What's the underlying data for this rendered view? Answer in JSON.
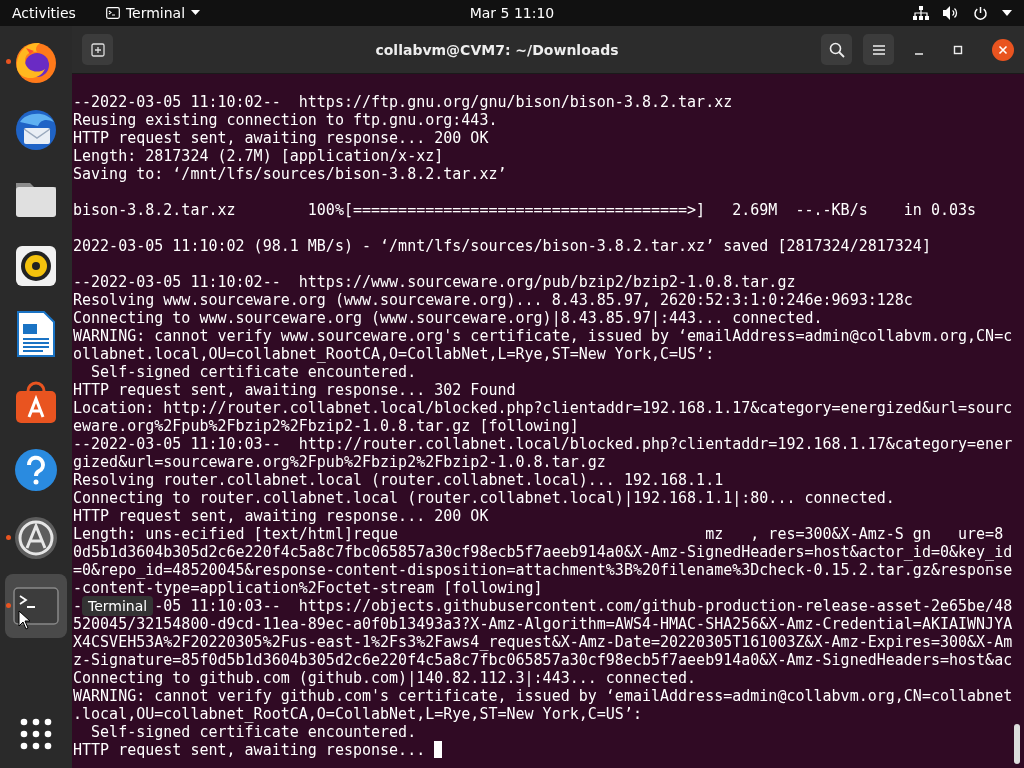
{
  "top_bar": {
    "activities": "Activities",
    "app_menu": "Terminal",
    "clock": "Mar 5  11:10"
  },
  "dock": {
    "items": [
      {
        "kind": "firefox",
        "running": true,
        "selected": false
      },
      {
        "kind": "mail",
        "running": false,
        "selected": false
      },
      {
        "kind": "files",
        "running": false,
        "selected": false
      },
      {
        "kind": "music",
        "running": false,
        "selected": false
      },
      {
        "kind": "writer",
        "running": false,
        "selected": false
      },
      {
        "kind": "store",
        "running": false,
        "selected": false
      },
      {
        "kind": "help",
        "running": false,
        "selected": false
      },
      {
        "kind": "updater",
        "running": true,
        "selected": false
      },
      {
        "kind": "terminal",
        "running": true,
        "selected": true
      }
    ],
    "tooltip": "Terminal"
  },
  "window": {
    "title": "collabvm@CVM7: ~/Downloads"
  },
  "terminal": {
    "lines": [
      {
        "kind": "text",
        "text": "--2022-03-05 11:10:02--  https://ftp.gnu.org/gnu/bison/bison-3.8.2.tar.xz"
      },
      {
        "kind": "text",
        "text": "Reusing existing connection to ftp.gnu.org:443."
      },
      {
        "kind": "text",
        "text": "HTTP request sent, awaiting response... 200 OK"
      },
      {
        "kind": "text",
        "text": "Length: 2817324 (2.7M) [application/x-xz]"
      },
      {
        "kind": "text",
        "text": "Saving to: ‘/mnt/lfs/sources/bison-3.8.2.tar.xz’"
      },
      {
        "kind": "blank"
      },
      {
        "kind": "text",
        "text": "bison-3.8.2.tar.xz        100%[=====================================>]   2.69M  --.-KB/s    in 0.03s"
      },
      {
        "kind": "blank"
      },
      {
        "kind": "text",
        "text": "2022-03-05 11:10:02 (98.1 MB/s) - ‘/mnt/lfs/sources/bison-3.8.2.tar.xz’ saved [2817324/2817324]"
      },
      {
        "kind": "blank"
      },
      {
        "kind": "text",
        "text": "--2022-03-05 11:10:02--  https://www.sourceware.org/pub/bzip2/bzip2-1.0.8.tar.gz"
      },
      {
        "kind": "text",
        "text": "Resolving www.sourceware.org (www.sourceware.org)... 8.43.85.97, 2620:52:3:1:0:246e:9693:128c"
      },
      {
        "kind": "text",
        "text": "Connecting to www.sourceware.org (www.sourceware.org)|8.43.85.97|:443... connected."
      },
      {
        "kind": "text",
        "text": "WARNING: cannot verify www.sourceware.org's certificate, issued by ‘emailAddress=admin@collabvm.org,CN=c"
      },
      {
        "kind": "text",
        "text": "ollabnet.local,OU=collabnet_RootCA,O=CollabNet,L=Rye,ST=New York,C=US’:"
      },
      {
        "kind": "text",
        "text": "  Self-signed certificate encountered."
      },
      {
        "kind": "text",
        "text": "HTTP request sent, awaiting response... 302 Found"
      },
      {
        "kind": "text",
        "text": "Location: http://router.collabnet.local/blocked.php?clientaddr=192.168.1.17&category=energized&url=sourc"
      },
      {
        "kind": "text",
        "text": "eware.org%2Fpub%2Fbzip2%2Fbzip2-1.0.8.tar.gz [following]"
      },
      {
        "kind": "text",
        "text": "--2022-03-05 11:10:03--  http://router.collabnet.local/blocked.php?clientaddr=192.168.1.17&category=ener"
      },
      {
        "kind": "text",
        "text": "gized&url=sourceware.org%2Fpub%2Fbzip2%2Fbzip2-1.0.8.tar.gz"
      },
      {
        "kind": "text",
        "text": "Resolving router.collabnet.local (router.collabnet.local)... 192.168.1.1"
      },
      {
        "kind": "text",
        "text": "Connecting to router.collabnet.local (router.collabnet.local)|192.168.1.1|:80... connected."
      },
      {
        "kind": "text",
        "text": "HTTP request sent, awaiting response... 200 OK"
      },
      {
        "kind": "text",
        "text": "Length: uns-ecified [text/html]reque                                  mz   , res=300&X-Amz-S gn   ure=8"
      },
      {
        "kind": "text",
        "text": "0d5b1d3604b305d2c6e220f4c5a8c7fbc065857a30cf98ecb5f7aeeb914a0&X-Amz-SignedHeaders=host&actor_id=0&key_id"
      },
      {
        "kind": "text",
        "text": "=0&repo_id=48520045&response-content-disposition=attachment%3B%20filename%3Dcheck-0.15.2.tar.gz&response"
      },
      {
        "kind": "text",
        "text": "-content-type=application%2Foctet-stream [following]"
      },
      {
        "kind": "covered",
        "segments": [
          "-",
          "-05 11:10:03--  https://objects.githubusercontent.com/github-production-release-asset-2e65be/48"
        ]
      },
      {
        "kind": "text",
        "text": "520045/32154800-d9cd-11ea-89ec-a0f0b13493a3?X-Amz-Algorithm=AWS4-HMAC-SHA256&X-Amz-Credential=AKIAIWNJYA"
      },
      {
        "kind": "text",
        "text": "X4CSVEH53A%2F20220305%2Fus-east-1%2Fs3%2Faws4_request&X-Amz-Date=20220305T161003Z&X-Amz-Expires=300&X-Am"
      },
      {
        "kind": "text",
        "text": "z-Signature=85f0d5b1d3604b305d2c6e220f4c5a8c7fbc065857a30cf98ecb5f7aeeb914a0&X-Amz-SignedHeaders=host&ac"
      },
      {
        "kind": "text",
        "text": "Connecting to github.com (github.com)|140.82.112.3|:443... connected."
      },
      {
        "kind": "text",
        "text": "WARNING: cannot verify github.com's certificate, issued by ‘emailAddress=admin@collabvm.org,CN=collabnet"
      },
      {
        "kind": "text",
        "text": ".local,OU=collabnet_RootCA,O=CollabNet,L=Rye,ST=New York,C=US’:"
      },
      {
        "kind": "text",
        "text": "  Self-signed certificate encountered."
      },
      {
        "kind": "text",
        "text": "HTTP request sent, awaiting response... ",
        "cursor": true
      }
    ]
  }
}
